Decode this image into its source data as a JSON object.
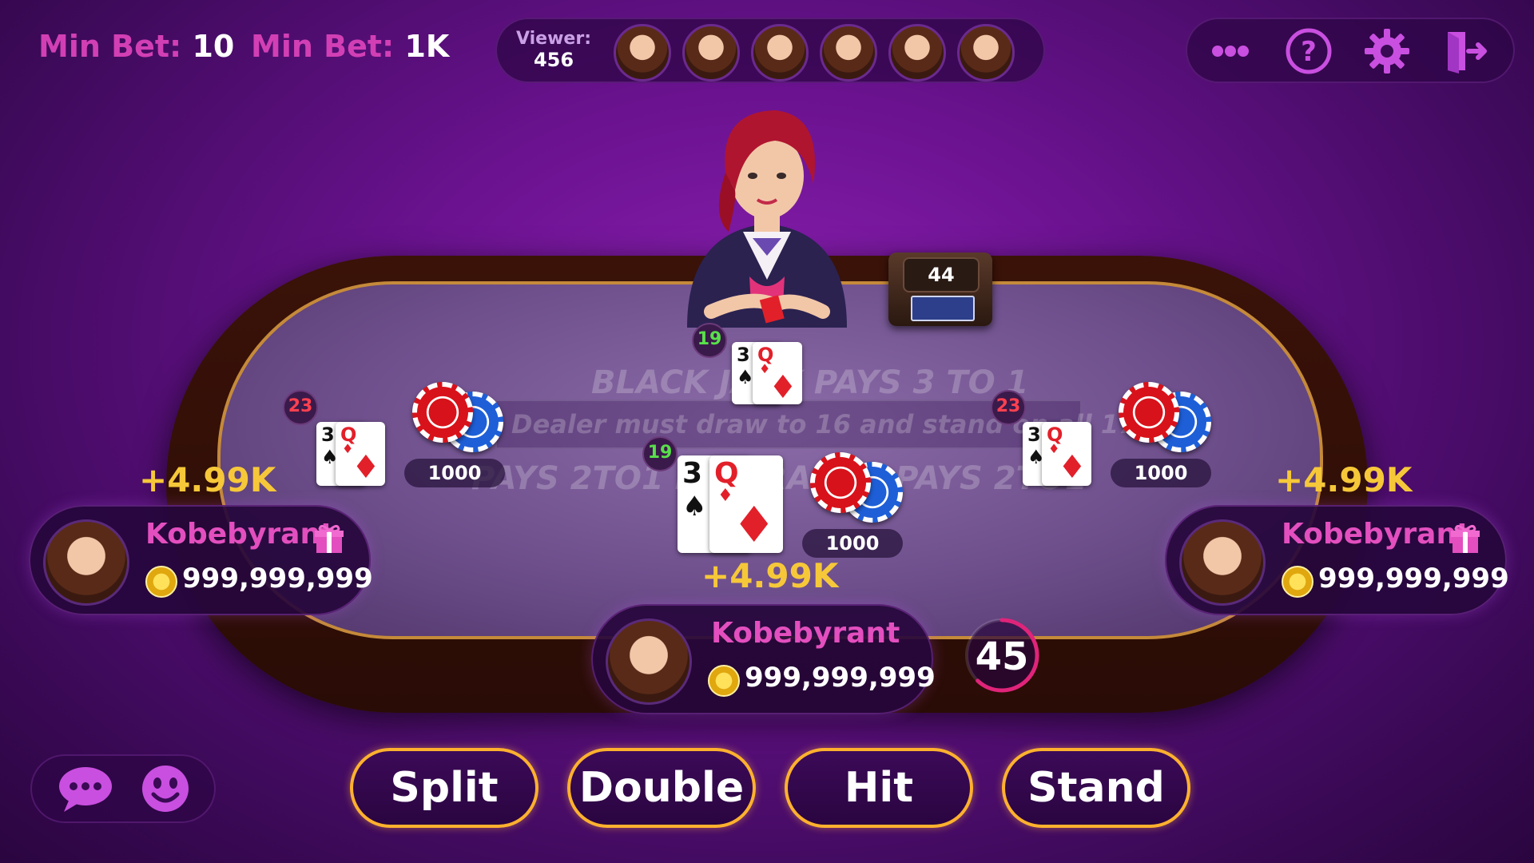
{
  "header": {
    "min_bet_1": {
      "label": "Min Bet:",
      "value": "10"
    },
    "min_bet_2": {
      "label": "Min Bet:",
      "value": "1K"
    },
    "viewer": {
      "label": "Viewer:",
      "count": "456",
      "avatars": 6
    }
  },
  "shoe": {
    "count": "44"
  },
  "felt": {
    "line1": "BLACK JACK PAYS 3 TO 1",
    "line2": "Dealer must draw to 16 and stand on all 17",
    "line3": "PAYS 2TO1   INSURANCE PAYS 2TO1"
  },
  "dealer": {
    "score": "19",
    "cards": [
      {
        "rank": "3",
        "suit": "spade"
      },
      {
        "rank": "Q",
        "suit": "diamond"
      }
    ]
  },
  "seats": {
    "left": {
      "score": "23",
      "cards": [
        {
          "rank": "3",
          "suit": "spade"
        },
        {
          "rank": "Q",
          "suit": "diamond"
        }
      ],
      "bet": "1000",
      "win": "+4.99K",
      "name": "Kobebyrant",
      "money": "999,999,999"
    },
    "center": {
      "score": "19",
      "cards": [
        {
          "rank": "3",
          "suit": "spade"
        },
        {
          "rank": "Q",
          "suit": "diamond"
        }
      ],
      "bet": "1000",
      "win": "+4.99K",
      "name": "Kobebyrant",
      "money": "999,999,999"
    },
    "right": {
      "score": "23",
      "cards": [
        {
          "rank": "3",
          "suit": "spade"
        },
        {
          "rank": "Q",
          "suit": "diamond"
        }
      ],
      "bet": "1000",
      "win": "+4.99K",
      "name": "Kobebyrant",
      "money": "999,999,999"
    }
  },
  "timer": {
    "value": "45",
    "fraction_remaining": 0.62
  },
  "actions": {
    "split": "Split",
    "double": "Double",
    "hit": "Hit",
    "stand": "Stand"
  },
  "icons": [
    "more-icon",
    "help-icon",
    "settings-icon",
    "exit-icon",
    "chat-icon",
    "emoji-icon",
    "gift-icon",
    "coin-icon"
  ],
  "colors": {
    "accent_pink": "#d23fb5",
    "gold": "#f6c839",
    "button_border": "#ffb12e",
    "win_gold": "#f6c839"
  }
}
